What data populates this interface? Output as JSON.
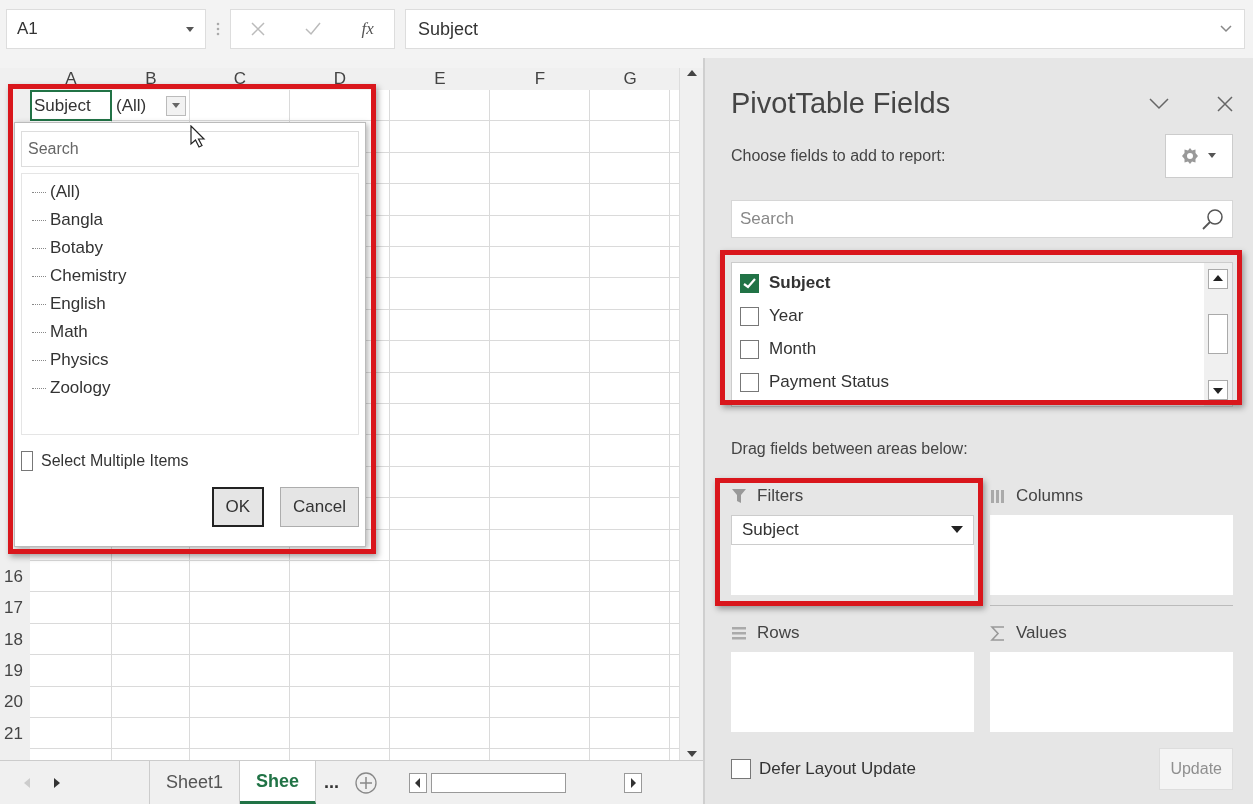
{
  "formula_bar": {
    "name_box": "A1",
    "function_label": "fx",
    "formula": "Subject"
  },
  "columns": [
    "A",
    "B",
    "C",
    "D",
    "E",
    "F",
    "G"
  ],
  "row_headers": [
    "16",
    "17",
    "18",
    "19",
    "20",
    "21"
  ],
  "cells": [
    {
      "text": "Subject",
      "selected": true
    },
    {
      "text": "(All)",
      "selected": false
    }
  ],
  "filter_popup": {
    "search_placeholder": "Search",
    "items": [
      "(All)",
      "Bangla",
      "Botaby",
      "Chemistry",
      "English",
      "Math",
      "Physics",
      "Zoology"
    ],
    "select_multiple": {
      "label": "Select Multiple Items",
      "checked": false
    },
    "buttons": [
      {
        "label": "OK",
        "default": true
      },
      {
        "label": "Cancel",
        "default": false
      }
    ]
  },
  "sheet_tabs": [
    {
      "label": "Sheet1",
      "selected": false
    },
    {
      "label": "Shee",
      "selected": true
    }
  ],
  "tab_overflow": "...",
  "panel": {
    "title": "PivotTable Fields",
    "subtitle": "Choose fields to add to report:",
    "search_placeholder": "Search",
    "fields": [
      {
        "label": "Subject",
        "checked": true
      },
      {
        "label": "Year",
        "checked": false
      },
      {
        "label": "Month",
        "checked": false
      },
      {
        "label": "Payment Status",
        "checked": false
      }
    ],
    "areas_caption": "Drag fields between areas below:",
    "areas": [
      {
        "kind": "filters",
        "label": "Filters",
        "items": [
          "Subject"
        ]
      },
      {
        "kind": "columns",
        "label": "Columns"
      },
      {
        "kind": "rows",
        "label": "Rows"
      },
      {
        "kind": "values",
        "label": "Values"
      }
    ],
    "defer": {
      "label": "Defer Layout Update",
      "checked": false
    },
    "update_button": {
      "label": "Update",
      "disabled": true
    }
  }
}
